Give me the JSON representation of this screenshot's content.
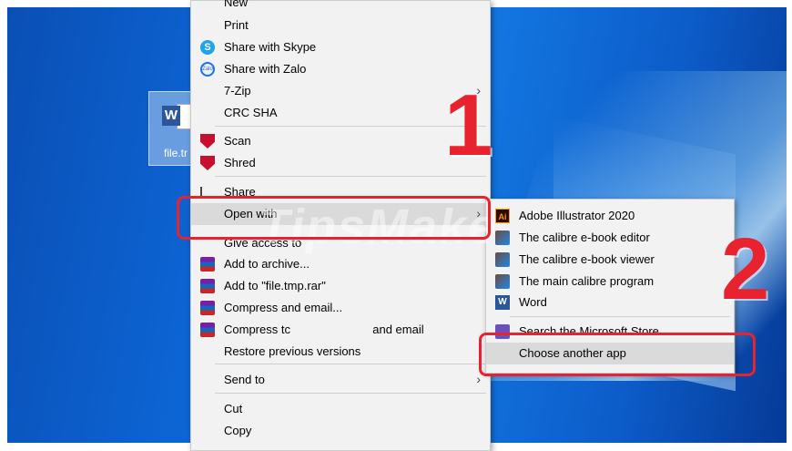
{
  "desktop": {
    "file_icon_label": "file.tr",
    "word_glyph": "W"
  },
  "context_menu": {
    "items": [
      {
        "label": "New"
      },
      {
        "label": "Print"
      },
      {
        "label": "Share with Skype",
        "icon": "skype-icon"
      },
      {
        "label": "Share with Zalo",
        "icon": "zalo-icon"
      },
      {
        "label": "7-Zip",
        "has_submenu": true
      },
      {
        "label": "CRC SHA",
        "has_submenu": true
      },
      {
        "label": "Scan",
        "icon": "mcafee-shield-icon"
      },
      {
        "label": "Shred",
        "icon": "mcafee-shield-icon"
      },
      {
        "label": "Share",
        "icon": "share-icon"
      },
      {
        "label": "Open with",
        "has_submenu": true,
        "highlighted": true
      },
      {
        "label": "Give access to",
        "has_submenu": true
      },
      {
        "label": "Add to archive...",
        "icon": "winrar-icon"
      },
      {
        "label": "Add to \"file.tmp.rar\"",
        "icon": "winrar-icon"
      },
      {
        "label": "Compress and email...",
        "icon": "winrar-icon"
      },
      {
        "label": "Compress tc                         and email",
        "icon": "winrar-icon"
      },
      {
        "label": "Restore previous versions"
      },
      {
        "label": "Send to",
        "has_submenu": true
      },
      {
        "label": "Cut"
      },
      {
        "label": "Copy"
      }
    ],
    "chevron": "›"
  },
  "open_with_submenu": {
    "items": [
      {
        "label": "Adobe Illustrator 2020",
        "icon": "illustrator-icon",
        "glyph": "Ai"
      },
      {
        "label": "The calibre e-book editor",
        "icon": "calibre-icon"
      },
      {
        "label": "The calibre e-book viewer",
        "icon": "calibre-icon"
      },
      {
        "label": "The main calibre program",
        "icon": "calibre-icon"
      },
      {
        "label": "Word",
        "icon": "word-icon",
        "glyph": "W"
      },
      {
        "label": "Search the Microsoft Store",
        "icon": "store-icon"
      },
      {
        "label": "Choose another app",
        "highlighted": true
      }
    ]
  },
  "annotations": {
    "step1": "1",
    "step2": "2",
    "accent_color": "#e8232f",
    "watermark": "TipsMake"
  },
  "colors": {
    "menu_bg": "#f2f2f2",
    "highlight": "#dadada",
    "desktop_blue": "#0d66d6"
  }
}
